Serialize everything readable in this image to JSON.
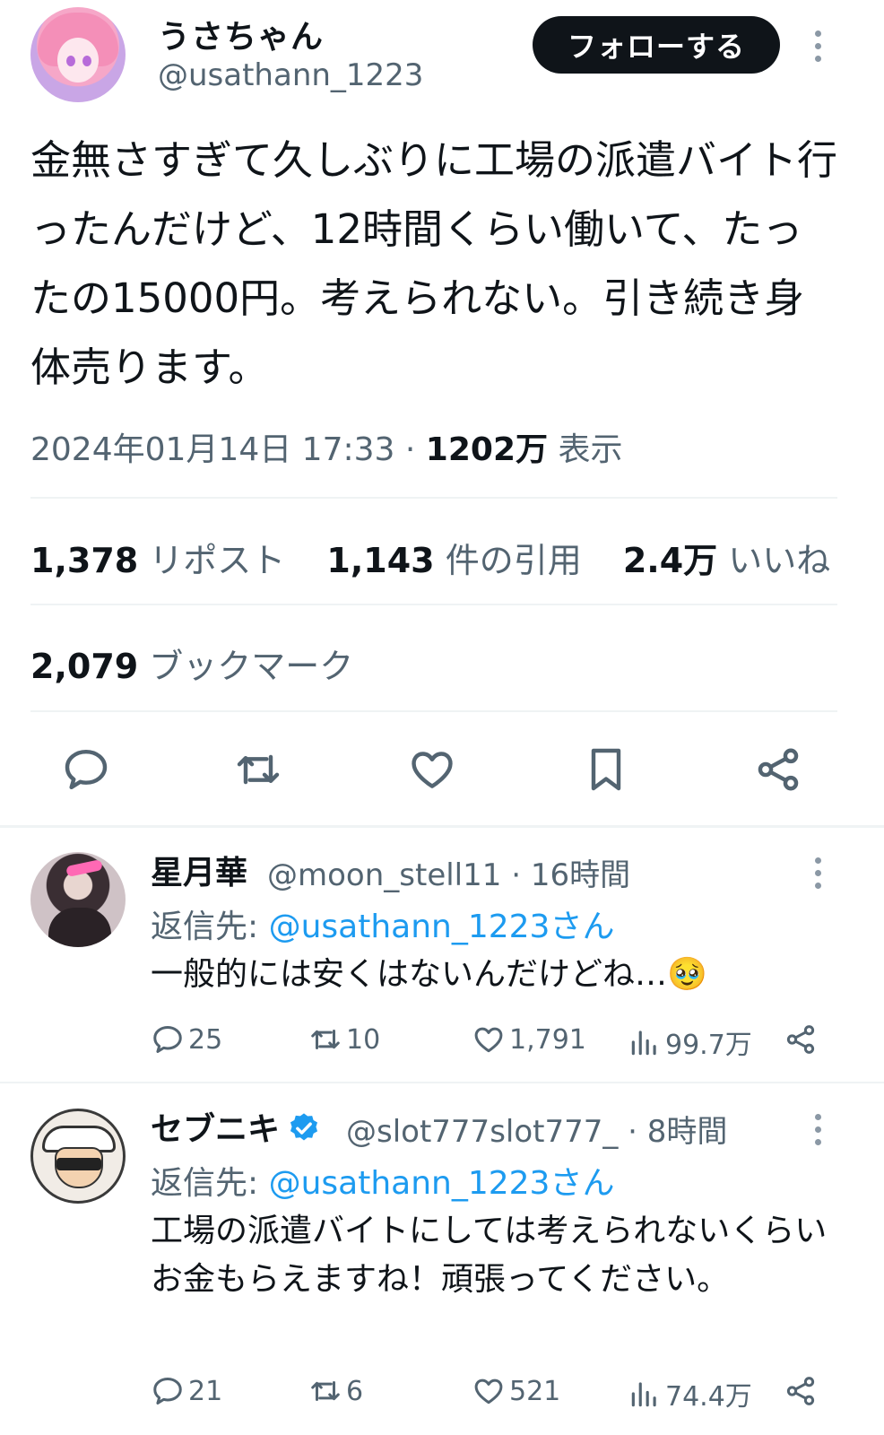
{
  "tweet": {
    "display_name": "うさちゃん",
    "handle": "@usathann_1223",
    "follow_label": "フォローする",
    "text": "金無さすぎて久しぶりに工場の派遣バイト行ったんだけど、12時間くらい働いて、たったの15000円。考えられない。引き続き身体売ります。",
    "timestamp": "2024年01月14日 17:33",
    "separator": "·",
    "views_count": "1202万",
    "views_label": "表示",
    "reposts_count": "1,378",
    "reposts_label": "リポスト",
    "quotes_count": "1,143",
    "quotes_label": "件の引用",
    "likes_count": "2.4万",
    "likes_label": "いいね",
    "bookmarks_count": "2,079",
    "bookmarks_label": "ブックマーク"
  },
  "actions": {
    "icons": [
      "reply-icon",
      "repost-icon",
      "like-icon",
      "bookmark-icon",
      "share-icon"
    ]
  },
  "replies": [
    {
      "display_name": "星月華",
      "handle_time": "@moon_stell11 · 16時間",
      "reply_prefix": "返信先: ",
      "reply_mention": "@usathann_1223さん",
      "text": "一般的には安くはないんだけどね…🥹",
      "replies": "25",
      "reposts": "10",
      "likes": "1,791",
      "views": "99.7万"
    },
    {
      "display_name": "セブニキ",
      "verified": true,
      "handle_time": "@slot777slot777_ · 8時間",
      "reply_prefix": "返信先: ",
      "reply_mention": "@usathann_1223さん",
      "text": "工場の派遣バイトにしては考えられないくらいお金もらえますね！頑張ってください。",
      "replies": "21",
      "reposts": "6",
      "likes": "521",
      "views": "74.4万"
    }
  ],
  "colors": {
    "text": "#0f1419",
    "secondary": "#536471",
    "link": "#1d9bf0",
    "divider": "#eff3f4",
    "button_bg": "#0f1419"
  }
}
